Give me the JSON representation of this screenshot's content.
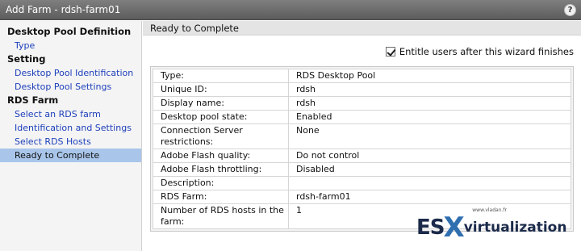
{
  "window": {
    "title": "Add Farm - rdsh-farm01",
    "help_label": "?"
  },
  "sidebar": {
    "sections": [
      {
        "title": "Desktop Pool Definition",
        "items": [
          {
            "label": "Type",
            "active": false
          }
        ]
      },
      {
        "title": "Setting",
        "items": [
          {
            "label": "Desktop Pool Identification",
            "active": false
          },
          {
            "label": "Desktop Pool Settings",
            "active": false
          }
        ]
      },
      {
        "title": "RDS Farm",
        "items": [
          {
            "label": "Select an RDS farm",
            "active": false
          },
          {
            "label": "Identification and Settings",
            "active": false
          },
          {
            "label": "Select RDS Hosts",
            "active": false
          },
          {
            "label": "Ready to Complete",
            "active": true
          }
        ]
      }
    ]
  },
  "main": {
    "header": "Ready to Complete",
    "entitle_checkbox": {
      "label": "Entitle users after this wizard finishes",
      "checked": true
    },
    "summary": [
      {
        "key": "Type:",
        "value": "RDS Desktop Pool"
      },
      {
        "key": "Unique ID:",
        "value": "rdsh"
      },
      {
        "key": "Display name:",
        "value": "rdsh"
      },
      {
        "key": "Desktop pool state:",
        "value": "Enabled"
      },
      {
        "key": "Connection Server restrictions:",
        "value": "None"
      },
      {
        "key": "Adobe Flash quality:",
        "value": "Do not control"
      },
      {
        "key": "Adobe Flash throttling:",
        "value": "Disabled"
      },
      {
        "key": "Description:",
        "value": ""
      },
      {
        "key": "RDS Farm:",
        "value": "rdsh-farm01"
      },
      {
        "key": "Number of RDS hosts in the farm:",
        "value": "1"
      }
    ]
  },
  "watermark": {
    "url": "www.vladan.fr",
    "logo_es": "ES",
    "logo_x": "X",
    "logo_rest": "virtualization"
  }
}
